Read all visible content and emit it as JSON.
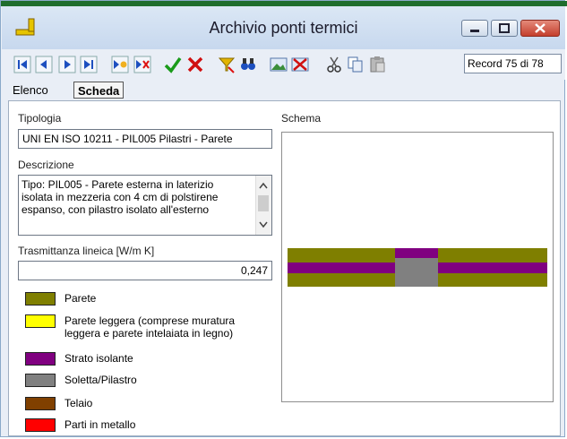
{
  "window": {
    "title": "Archivio ponti termici"
  },
  "toolbar": {
    "record_label": "Record 75 di 78"
  },
  "tabs": [
    {
      "label": "Elenco"
    },
    {
      "label": "Scheda"
    }
  ],
  "form": {
    "tipologia_label": "Tipologia",
    "tipologia_value": "UNI EN ISO 10211 - PIL005 Pilastri - Parete",
    "descrizione_label": "Descrizione",
    "descrizione_lines": [
      "Tipo: PIL005 - Parete esterna in laterizio",
      "isolata in mezzeria con 4 cm di polstirene",
      "espanso, con pilastro isolato all'esterno"
    ],
    "trasmittanza_label": "Trasmittanza lineica [W/m K]",
    "trasmittanza_value": "0,247",
    "schema_label": "Schema"
  },
  "legend": [
    {
      "label": "Parete",
      "color": "#7f7f00"
    },
    {
      "label": "Parete leggera (comprese muratura",
      "label2": "leggera e parete intelaiata in legno)",
      "color": "#ffff00"
    },
    {
      "label": "Strato isolante",
      "color": "#800080"
    },
    {
      "label": "Soletta/Pilastro",
      "color": "#808080"
    },
    {
      "label": "Telaio",
      "color": "#804000"
    },
    {
      "label": "Parti in metallo",
      "color": "#ff0000"
    }
  ]
}
